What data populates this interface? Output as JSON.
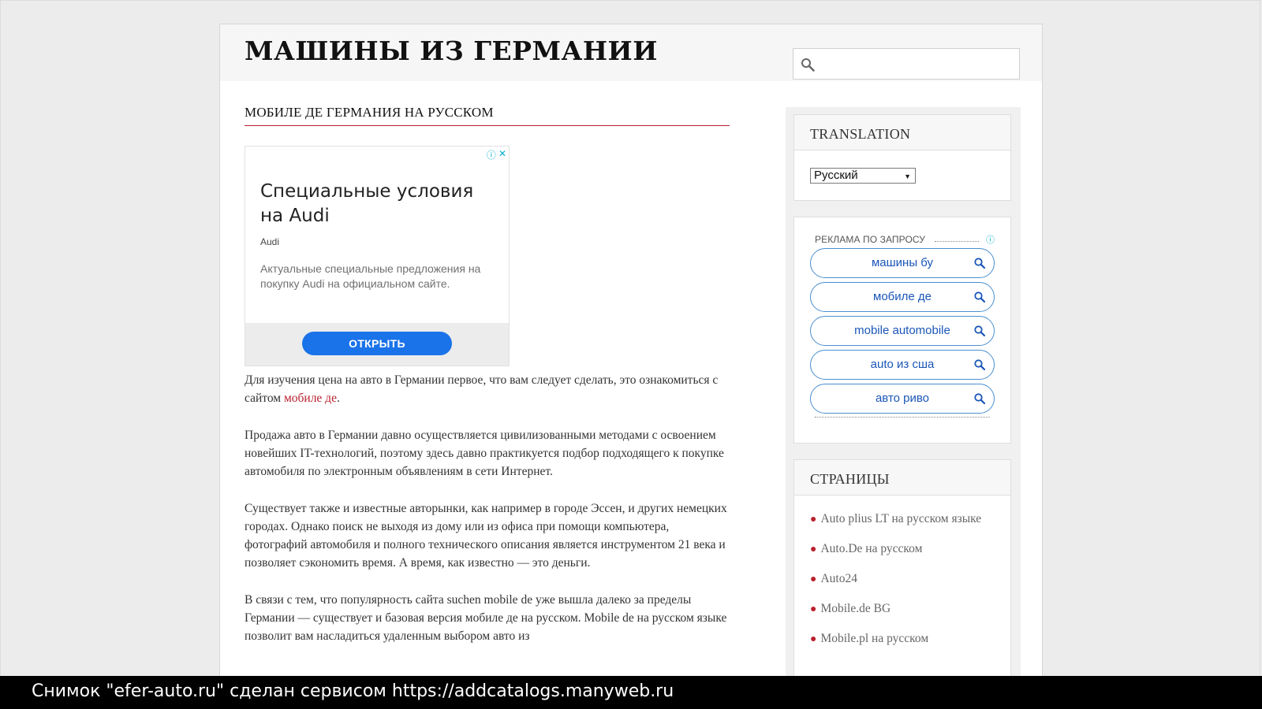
{
  "header": {
    "site_title": "МАШИНЫ ИЗ ГЕРМАНИИ",
    "search_placeholder": ""
  },
  "post": {
    "title": "МОБИЛЕ ДЕ ГЕРМАНИЯ НА РУССКОМ",
    "p1_text": "Для изучения цена на авто в Германии первое, что вам следует сделать, это ознакомиться с сайтом ",
    "p1_link": "мобиле де",
    "p1_end": ".",
    "p2": "Продажа авто в Германии давно осуществляется цивилизованными методами с освоением новейших IT-технологий, поэтому здесь давно практикуется подбор подходящего к покупке автомобиля по электронным объявлениям в сети Интернет.",
    "p3": "Существует также и известные авторынки, как например в городе Эссен, и других немецких городах. Однако поиск не выходя из дому или из офиса при помощи компьютера, фотографий автомобиля и полного технического описания является инструментом 21 века и позволяет сэкономить время. А время, как известно — это деньги.",
    "p4": "В связи с тем, что популярность сайта suchen mobile de уже вышла далеко за пределы Германии — существует и базовая версия мобиле де на русском. Mobile de на русском языке позволит вам насладиться удаленным выбором авто из"
  },
  "ad": {
    "info_icon": "ⓘ",
    "close_icon": "✕",
    "headline": "Специальные условия на Audi",
    "brand": "Audi",
    "description": "Актуальные специальные предложения на покупку Audi на официальном сайте.",
    "button": "ОТКРЫТЬ"
  },
  "sidebar": {
    "translation": {
      "title": "TRANSLATION",
      "selected_language": "Русский"
    },
    "ads": {
      "label": "РЕКЛАМА ПО ЗАПРОСУ",
      "info_icon": "ⓘ",
      "links": [
        "машины бу",
        "мобиле де",
        "mobile automobile",
        "auto из сша",
        "авто риво"
      ]
    },
    "pages": {
      "title": "СТРАНИЦЫ",
      "items": [
        "Auto plius LT на русском языке",
        "Auto.De на русском",
        "Auto24",
        "Mobile.de BG",
        "Mobile.pl на русском"
      ]
    }
  },
  "caption": "Снимок \"efer-auto.ru\" сделан сервисом https://addcatalogs.manyweb.ru",
  "colors": {
    "accent_red": "#b9212e",
    "ad_button_blue": "#1a73e8",
    "ad_link_blue": "#1a56b8",
    "info_cyan": "#00aecd"
  }
}
